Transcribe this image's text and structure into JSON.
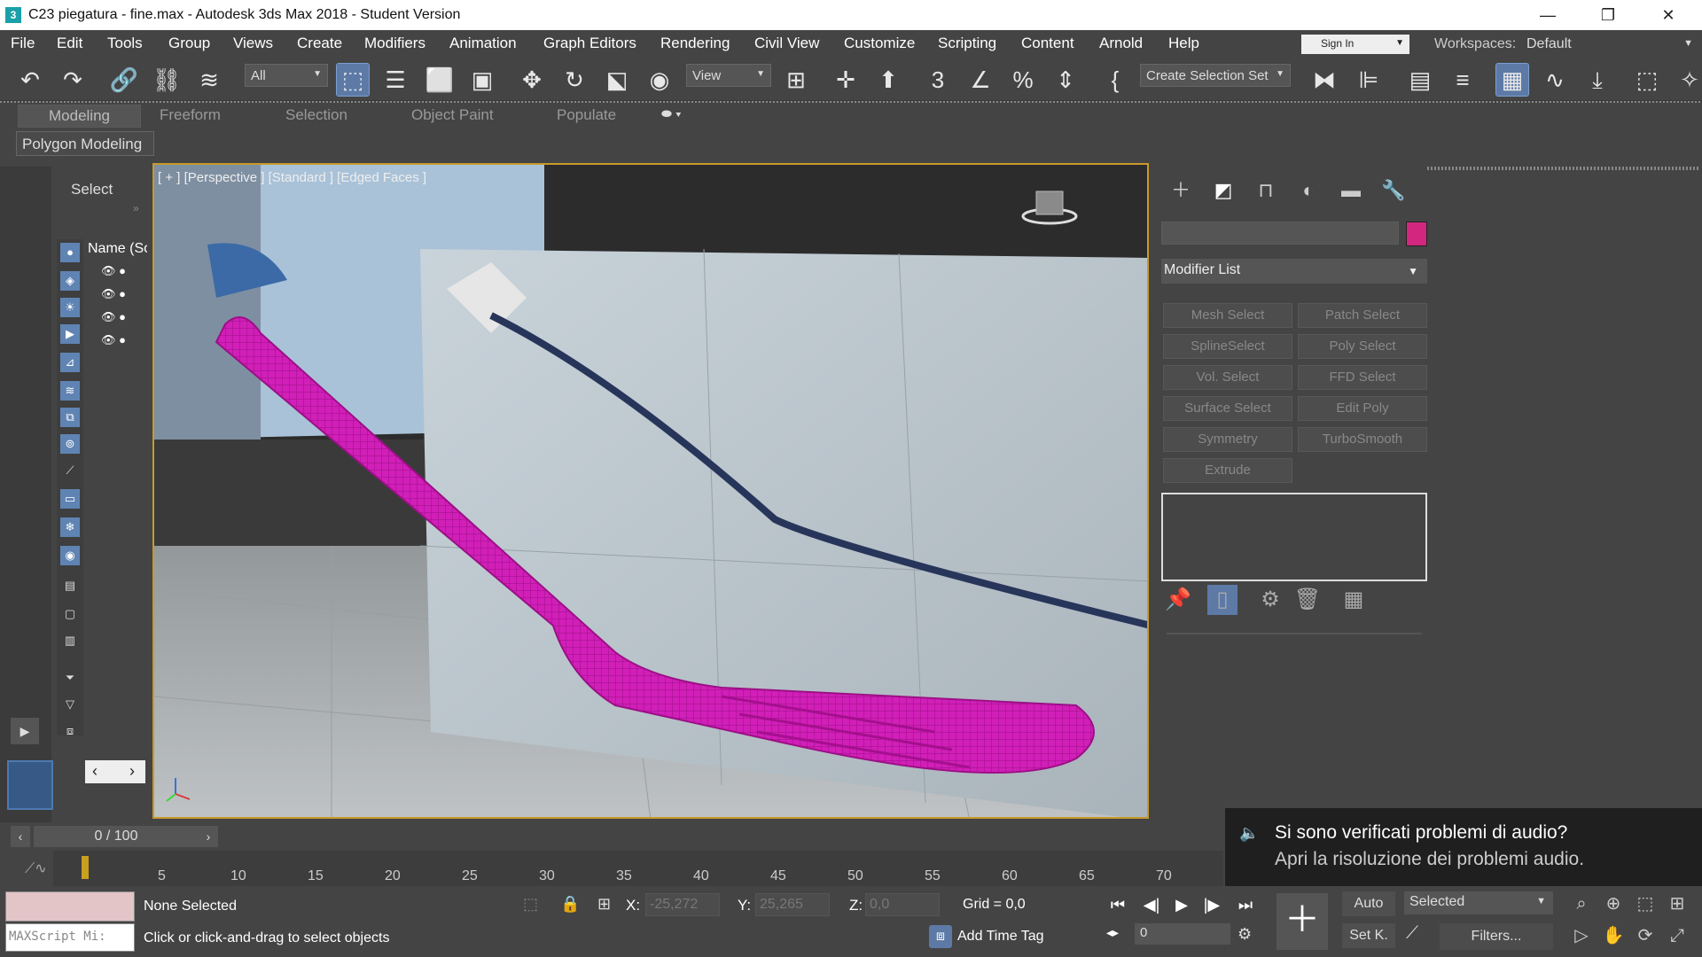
{
  "window": {
    "title": "C23 piegatura - fine.max - Autodesk 3ds Max 2018 - Student Version",
    "app_icon": "3"
  },
  "menu": [
    "File",
    "Edit",
    "Tools",
    "Group",
    "Views",
    "Create",
    "Modifiers",
    "Animation",
    "Graph Editors",
    "Rendering",
    "Civil View",
    "Customize",
    "Scripting",
    "Content",
    "Arnold",
    "Help"
  ],
  "account": {
    "signin_label": "Sign In",
    "workspaces_label": "Workspaces:",
    "workspace_value": "Default"
  },
  "toolbar": {
    "filter_value": "All",
    "refcoord_value": "View",
    "selection_set_label": "Create Selection Set"
  },
  "ribbon": {
    "tabs": [
      "Modeling",
      "Freeform",
      "Selection",
      "Object Paint",
      "Populate"
    ],
    "panel_label": "Polygon Modeling"
  },
  "scene_explorer": {
    "select_label": "Select",
    "name_header": "Name (So"
  },
  "viewport": {
    "label": "[ + ] [Perspective ]  [Standard ]  [Edged Faces ]"
  },
  "command_panel": {
    "modifier_list_label": "Modifier List",
    "selected_color": "#d3277f",
    "modifiers": [
      [
        "Mesh Select",
        "Patch Select"
      ],
      [
        "SplineSelect",
        "Poly Select"
      ],
      [
        "Vol. Select",
        "FFD Select"
      ],
      [
        "Surface Select",
        "Edit Poly"
      ],
      [
        "Symmetry",
        "TurboSmooth"
      ],
      [
        "Extrude"
      ]
    ]
  },
  "timeline": {
    "frame_label": "0 / 100",
    "ticks": [
      "5",
      "10",
      "15",
      "20",
      "25",
      "30",
      "35",
      "40",
      "45",
      "50",
      "55",
      "60",
      "65",
      "70"
    ]
  },
  "status": {
    "maxscript_placeholder": "MAXScript Mi:",
    "selection_text": "None Selected",
    "prompt_text": "Click or click-and-drag to select objects",
    "x_label": "X:",
    "x_value": "-25,272",
    "y_label": "Y:",
    "y_value": "25,265",
    "z_label": "Z:",
    "z_value": "0,0",
    "grid_text": "Grid = 0,0",
    "add_time_tag": "Add Time Tag",
    "current_frame": "0",
    "auto_key": "Auto",
    "set_key": "Set K.",
    "key_filter_value": "Selected",
    "filters_label": "Filters..."
  },
  "notification": {
    "title": "Si sono verificati problemi di audio?",
    "body": "Apri la risoluzione dei problemi audio."
  }
}
